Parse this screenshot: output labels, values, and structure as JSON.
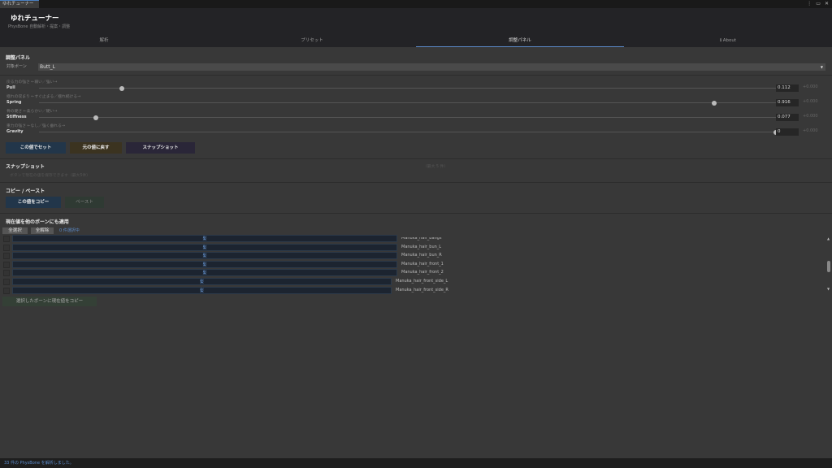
{
  "window": {
    "tab_title": "ゆれチューナー"
  },
  "header": {
    "title": "ゆれチューナー",
    "subtitle": "PhysBone 自動解析・提案・調整"
  },
  "tabs": [
    {
      "label": "解析"
    },
    {
      "label": "プリセット"
    },
    {
      "label": "調整パネル",
      "active": true
    },
    {
      "label": "ℹ About"
    }
  ],
  "panel": {
    "heading": "調整パネル",
    "target_label": "対象ボーン",
    "target_value": "Butt_L",
    "params": [
      {
        "hint": "戻る力の強さ ←弱い／強い→",
        "name": "Pull",
        "value": "0.112",
        "fraction": 0.112,
        "delta": "+0.000"
      },
      {
        "hint": "揺れの収まり ←すぐ止まる／揺れ続ける→",
        "name": "Spring",
        "value": "0.916",
        "fraction": 0.916,
        "delta": "+0.000"
      },
      {
        "hint": "骨の硬さ ←柔らかい／硬い→",
        "name": "Stiffness",
        "value": "0.077",
        "fraction": 0.077,
        "delta": "+0.000"
      },
      {
        "hint": "重力の強さ ←なし／強く垂れる→",
        "name": "Gravity",
        "value": "0",
        "fraction": 1.0,
        "delta": "+0.000"
      }
    ],
    "buttons": {
      "set": "この値でセット",
      "revert": "元の値に戻す",
      "snapshot": "スナップショット"
    },
    "colors": {
      "set": "#22364a",
      "revert": "#3b3320",
      "snapshot": "#2a2638"
    }
  },
  "snapshot": {
    "heading": "スナップショット",
    "hint": "ボタンで現在の値を保存できます（最大5件）",
    "max": "（最大 5 件）"
  },
  "copypaste": {
    "heading": "コピー / ペースト",
    "copy": "この値をコピー",
    "paste": "ペースト"
  },
  "apply": {
    "heading": "現在値を他のボーンにも適用",
    "select_all": "全選択",
    "deselect_all": "全解除",
    "selected_count": "0 件選択中",
    "rows": [
      {
        "group": "髪",
        "name": "Manuka_hair_bangs"
      },
      {
        "group": "髪",
        "name": "Manuka_hair_bun_L"
      },
      {
        "group": "髪",
        "name": "Manuka_hair_bun_R"
      },
      {
        "group": "髪",
        "name": "Manuka_hair_front_1"
      },
      {
        "group": "髪",
        "name": "Manuka_hair_front_2"
      },
      {
        "group": "髪",
        "name": "Manuka_hair_front_side_L"
      },
      {
        "group": "髪",
        "name": "Manuka_hair_front_side_R"
      }
    ],
    "copy_selected": "選択したボーンに現在値をコピー"
  },
  "status": "33 件の PhysBone を解析しました。"
}
